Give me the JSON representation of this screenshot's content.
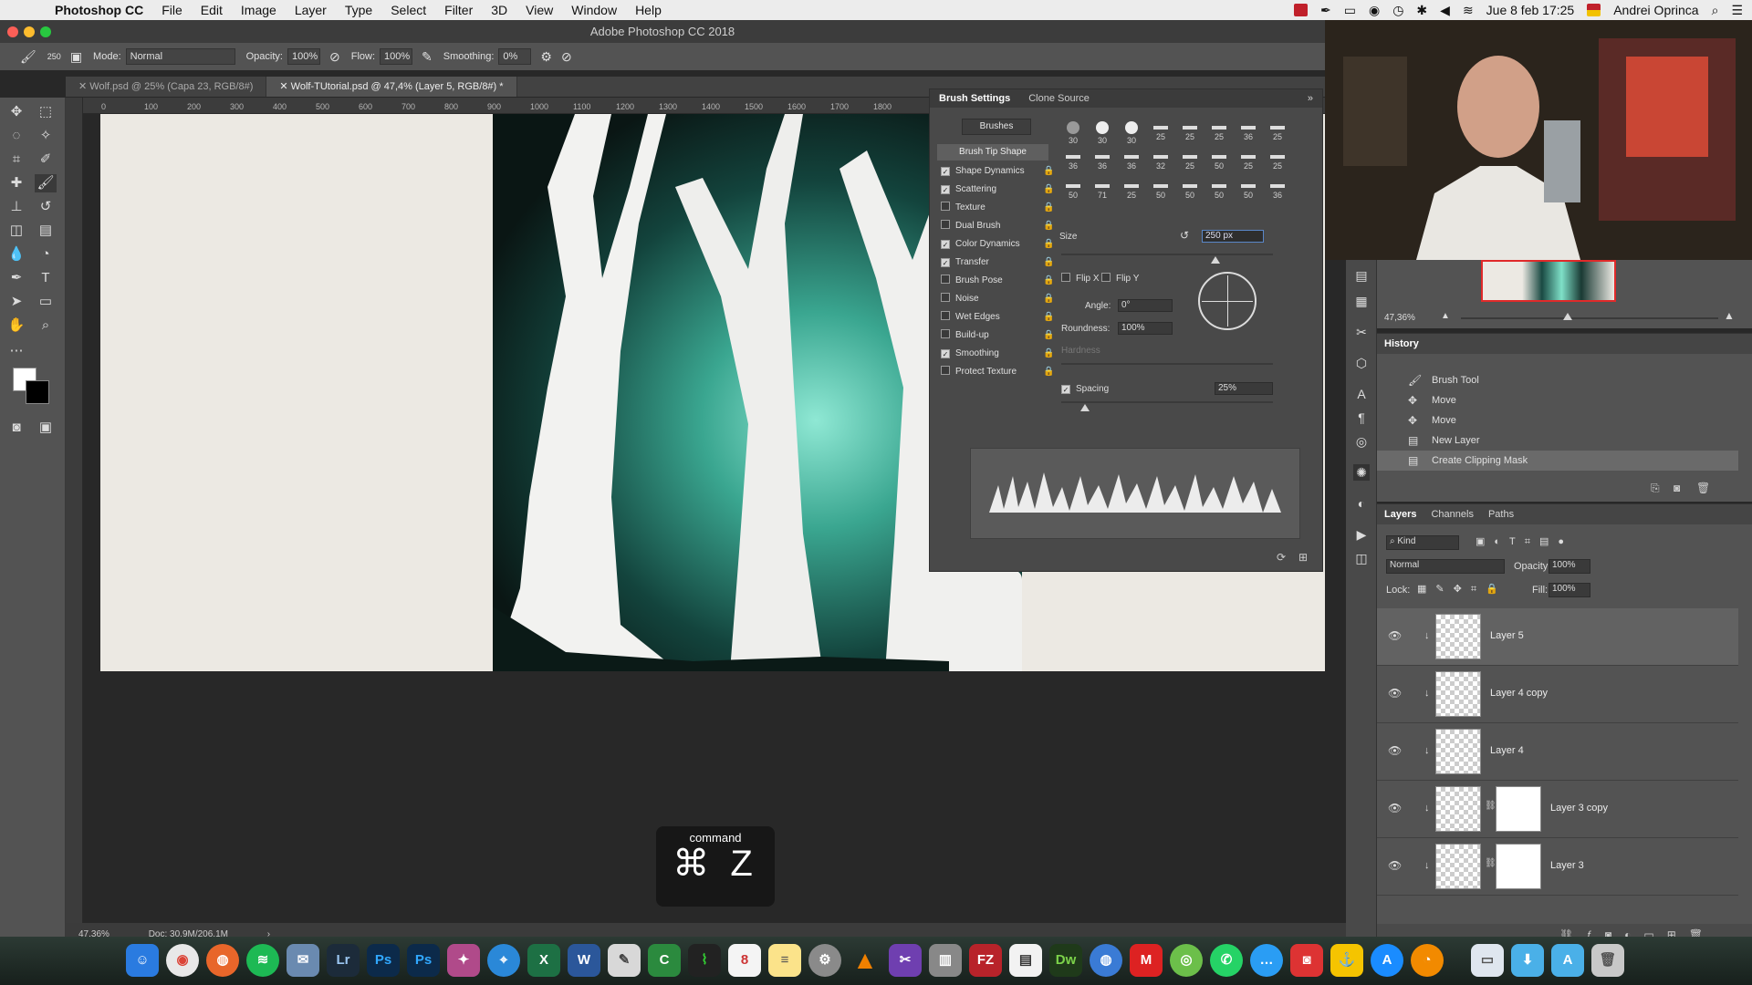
{
  "menubar": {
    "app_name": "Photoshop CC",
    "items": [
      "File",
      "Edit",
      "Image",
      "Layer",
      "Type",
      "Select",
      "Filter",
      "3D",
      "View",
      "Window",
      "Help"
    ],
    "datetime": "Jue 8 feb 17:25",
    "user": "Andrei Oprinca"
  },
  "window": {
    "title": "Adobe Photoshop CC 2018"
  },
  "options": {
    "brush_size": "250",
    "mode_label": "Mode:",
    "mode_value": "Normal",
    "opacity_label": "Opacity:",
    "opacity_value": "100%",
    "flow_label": "Flow:",
    "flow_value": "100%",
    "smoothing_label": "Smoothing:",
    "smoothing_value": "0%"
  },
  "tabs": [
    {
      "label": "Wolf.psd @ 25% (Capa 23, RGB/8#)"
    },
    {
      "label": "Wolf-TUtorial.psd @ 47,4% (Layer 5, RGB/8#) *"
    }
  ],
  "ruler_ticks": [
    "0",
    "100",
    "200",
    "300",
    "400",
    "500",
    "600",
    "700",
    "800",
    "900",
    "1000",
    "1100",
    "1200",
    "1300",
    "1400",
    "1500",
    "1600",
    "1700",
    "1800"
  ],
  "brush_panel": {
    "tabs": [
      "Brush Settings",
      "Clone Source"
    ],
    "brushes_button": "Brushes",
    "tip_shape": "Brush Tip Shape",
    "options": [
      {
        "label": "Shape Dynamics",
        "checked": true
      },
      {
        "label": "Scattering",
        "checked": true
      },
      {
        "label": "Texture",
        "checked": false
      },
      {
        "label": "Dual Brush",
        "checked": false
      },
      {
        "label": "Color Dynamics",
        "checked": true
      },
      {
        "label": "Transfer",
        "checked": true
      },
      {
        "label": "Brush Pose",
        "checked": false
      },
      {
        "label": "Noise",
        "checked": false
      },
      {
        "label": "Wet Edges",
        "checked": false
      },
      {
        "label": "Build-up",
        "checked": false
      },
      {
        "label": "Smoothing",
        "checked": true
      },
      {
        "label": "Protect Texture",
        "checked": false
      }
    ],
    "preset_sizes": [
      "30",
      "30",
      "30",
      "25",
      "25",
      "25",
      "36",
      "25",
      "36",
      "36",
      "36",
      "32",
      "25",
      "50",
      "25",
      "25",
      "50",
      "71",
      "25",
      "50",
      "50",
      "50",
      "50",
      "36"
    ],
    "size_label": "Size",
    "size_value": "250 px",
    "flip_x": "Flip X",
    "flip_y": "Flip Y",
    "angle_label": "Angle:",
    "angle_value": "0°",
    "roundness_label": "Roundness:",
    "roundness_value": "100%",
    "hardness_label": "Hardness",
    "spacing_label": "Spacing",
    "spacing_value": "25%"
  },
  "navigator": {
    "zoom": "47,36%"
  },
  "history": {
    "title": "History",
    "items": [
      "Brush Tool",
      "Move",
      "Move",
      "New Layer",
      "Create Clipping Mask"
    ]
  },
  "layers_panel": {
    "tabs": [
      "Layers",
      "Channels",
      "Paths"
    ],
    "kind": "Kind",
    "blend_mode": "Normal",
    "opacity_label": "Opacity:",
    "opacity_value": "100%",
    "lock_label": "Lock:",
    "fill_label": "Fill:",
    "fill_value": "100%",
    "layers": [
      "Layer 5",
      "Layer 4 copy",
      "Layer 4",
      "Layer 3 copy",
      "Layer 3"
    ]
  },
  "status": {
    "zoom": "47,36%",
    "doc": "Doc: 30,9M/206,1M"
  },
  "key_overlay": {
    "word": "command",
    "keys": "⌘ Z"
  },
  "dock": {
    "apps": [
      "Lr",
      "Ps",
      "Ps",
      "Dw",
      "FZ"
    ]
  },
  "colors": {
    "accent": "#5a87c8",
    "ui_dark": "#535353",
    "forest_glow": "#8fe8d4"
  }
}
